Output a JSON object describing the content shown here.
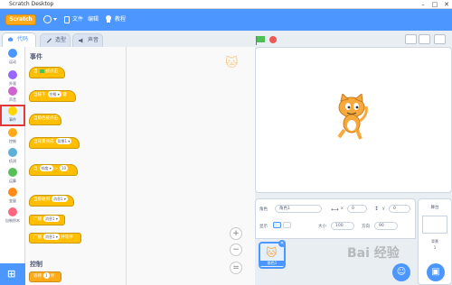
{
  "window": {
    "title": "Scratch Desktop",
    "minimize": "–",
    "maximize": "□",
    "close": "✕"
  },
  "menubar": {
    "logo": "Scratch",
    "items": [
      "文件",
      "编辑",
      "教程"
    ]
  },
  "tabs": [
    {
      "label": "代码",
      "icon": "code-icon"
    },
    {
      "label": "造型",
      "icon": "brush-icon"
    },
    {
      "label": "声音",
      "icon": "speaker-icon"
    }
  ],
  "categories": [
    {
      "label": "运动",
      "color": "#4c97ff"
    },
    {
      "label": "外观",
      "color": "#9966ff"
    },
    {
      "label": "声音",
      "color": "#cf63cf"
    },
    {
      "label": "事件",
      "color": "#ffd500",
      "selected": true
    },
    {
      "label": "控制",
      "color": "#ffab19"
    },
    {
      "label": "侦测",
      "color": "#5cb1d6"
    },
    {
      "label": "运算",
      "color": "#59c059"
    },
    {
      "label": "变量",
      "color": "#ff8c1a"
    },
    {
      "label": "自制积木",
      "color": "#ff6680"
    }
  ],
  "palette": {
    "events_title": "事件",
    "control_title": "控制",
    "blocks": [
      {
        "text": "当",
        "suffix": "被点击",
        "has_flag": true
      },
      {
        "text": "当按下",
        "pill": "空格 ▾",
        "suffix": "键"
      },
      {
        "text": "当角色被点击"
      },
      {
        "text": "当背景换成",
        "pill": "背景1 ▾"
      },
      {
        "text": "当",
        "pill": "响度 ▾",
        "suffix": ">",
        "value": "10"
      },
      {
        "text": "当接收到",
        "pill": "消息1 ▾"
      },
      {
        "text": "广播",
        "pill": "消息1 ▾"
      },
      {
        "text": "广播",
        "pill": "消息1 ▾",
        "suffix": "并等待"
      }
    ],
    "control_block": {
      "text": "等待",
      "value": "1",
      "suffix": "秒"
    }
  },
  "zoom": {
    "in": "+",
    "out": "−",
    "reset": "="
  },
  "sprite_info": {
    "sprite_label": "角色",
    "sprite_name": "角色1",
    "x_label": "x",
    "x_value": "0",
    "y_label": "y",
    "y_value": "0",
    "show_label": "显示",
    "size_label": "大小",
    "size_value": "100",
    "direction_label": "方向",
    "direction_value": "90"
  },
  "sprite_list": [
    {
      "name": "角色1"
    }
  ],
  "stage_panel": {
    "title": "舞台",
    "backdrop_label": "背景",
    "backdrop_count": "1"
  },
  "watermark": "Bai 经验"
}
